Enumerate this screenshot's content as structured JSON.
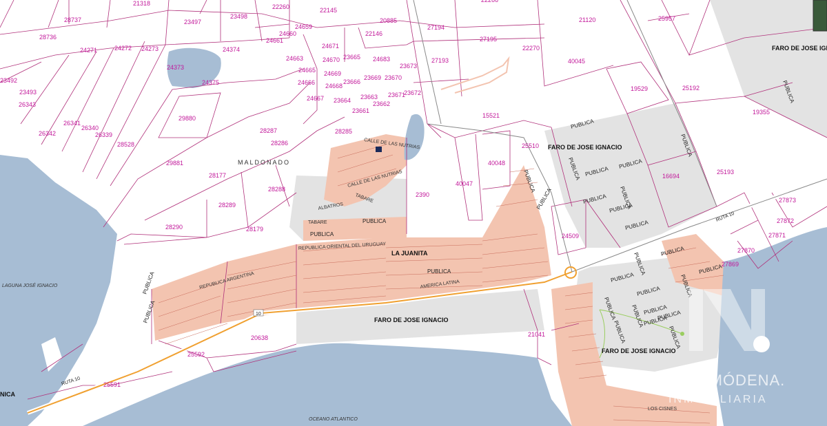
{
  "parcels": [
    "21318",
    "28737",
    "28736",
    "23497",
    "23498",
    "22260",
    "22145",
    "22266",
    "27194",
    "27195",
    "27193",
    "21120",
    "25957",
    "24271",
    "24272",
    "24273",
    "24374",
    "24373",
    "24375",
    "23492",
    "23493",
    "26343",
    "26341",
    "26340",
    "26342",
    "26339",
    "28528",
    "29880",
    "29881",
    "28287",
    "28286",
    "28285",
    "28177",
    "28289",
    "28288",
    "28290",
    "28179",
    "24659",
    "24660",
    "24661",
    "24663",
    "24665",
    "24666",
    "24667",
    "24671",
    "24670",
    "24669",
    "24668",
    "23665",
    "23666",
    "23669",
    "23670",
    "24683",
    "23673",
    "23664",
    "23663",
    "23661",
    "23662",
    "23671",
    "23672",
    "20885",
    "22146",
    "22270",
    "40045",
    "19529",
    "25192",
    "19355",
    "15521",
    "25510",
    "40048",
    "40047",
    "2390",
    "16694",
    "25193",
    "27873",
    "27872",
    "27871",
    "27870",
    "27869",
    "24509",
    "20638",
    "25592",
    "25591",
    "21041"
  ],
  "place_labels": {
    "maldonado": "MALDONADO",
    "la_juanita": "LA JUANITA",
    "faro_1": "FARO DE JOSE IGNACIO",
    "faro_2": "FARO DE JOSE IGNACIO",
    "faro_3": "FARO DE JOSE IGNACIO",
    "faro_4": "FARO DE JOSE IGNACIO",
    "nica": "NICA"
  },
  "public_label": "PUBLICA",
  "streets": {
    "calle_nutrias": "CALLE DE LAS NUTRIAS",
    "tabare": "TABARE",
    "albatros": "ALBATROS",
    "republica_oriental": "REPUBLICA ORIENTAL DEL URUGUAY",
    "republica_argentina": "REPUBLICA ARGENTINA",
    "america_latina": "AMERICA LATINA",
    "los_cisnes": "LOS CISNES",
    "ruta_10": "RUTA 10",
    "route_number": "10"
  },
  "water": {
    "laguna": "LAGUNA JOSÉ IGNACIO",
    "oceano": "OCEANO ATLANTICO"
  },
  "watermark": {
    "line1": "TOMÁS DE MÓDENA.",
    "line2": "INMOBILIARIA"
  },
  "colors": {
    "water": "#a7bdd4",
    "public_area": "#e3e3e3",
    "urban": "#f3c4b0",
    "parcel_line": "#b0307a",
    "route": "#f0a030"
  }
}
